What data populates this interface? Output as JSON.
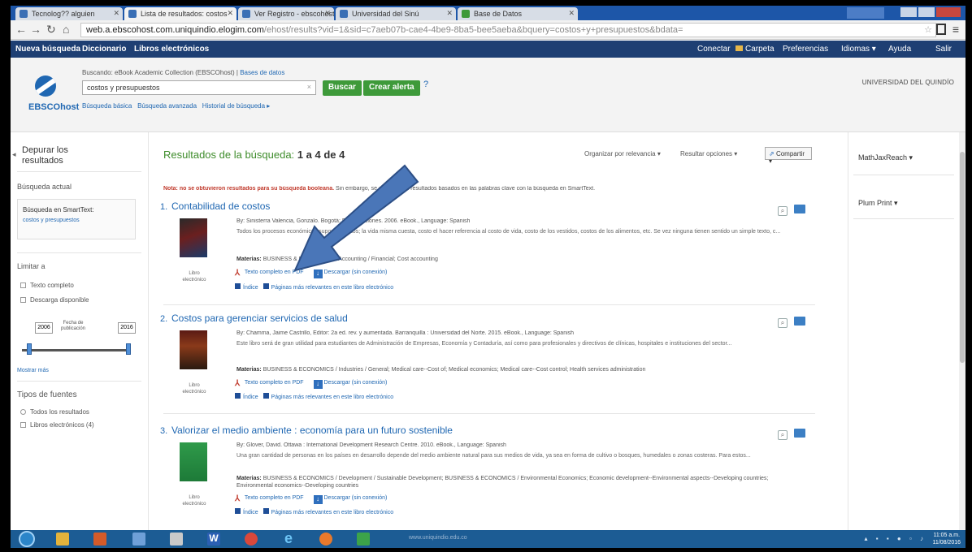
{
  "browser": {
    "tabs": [
      {
        "label": "Tecnolog?? alguien"
      },
      {
        "label": "Lista de resultados: costos"
      },
      {
        "label": "Ver Registro - ebscohost"
      },
      {
        "label": "Universidad del Sinú"
      },
      {
        "label": "Base de Datos"
      }
    ],
    "url_main": "web.a.ebscohost.com.uniquindio.elogim.com",
    "url_rest": "/ehost/results?vid=1&sid=c7aeb07b-cae4-4be9-8ba5-bee5aeba&bquery=costos+y+presupuestos&bdata="
  },
  "toolbar": {
    "left": [
      "Nueva búsqueda",
      "Diccionario",
      "Libros electrónicos"
    ],
    "right": [
      "Conectar",
      "Carpeta",
      "Preferencias",
      "Idiomas",
      "Ayuda",
      "Salir"
    ]
  },
  "header": {
    "searching_label": "Buscando: eBook Academic Collection (EBSCOhost)",
    "searching_link": "Bases de datos",
    "query": "costos y presupuestos",
    "search_button": "Buscar",
    "alert_button": "Crear alerta",
    "help": "?",
    "links": [
      "Búsqueda básica",
      "Búsqueda avanzada",
      "Historial de búsqueda"
    ],
    "institution": "UNIVERSIDAD DEL QUINDÍO",
    "logo": "EBSCOhost"
  },
  "left": {
    "refine_title": "Depurar los resultados",
    "current_search": "Búsqueda actual",
    "smarttext_title": "Búsqueda en SmartText:",
    "smarttext_link": "costos y presupuestos",
    "limit_to": "Limitar a",
    "opt_fulltext": "Texto completo",
    "opt_download": "Descarga disponible",
    "year_from": "2006",
    "year_to": "2016",
    "pubdate_label": "Fecha de publicación",
    "show_more": "Mostrar más",
    "source_types": "Tipos de fuentes",
    "opt_all": "Todos los resultados",
    "opt_ebooks": "Libros electrónicos (4)"
  },
  "main": {
    "results_label": "Resultados de la búsqueda:",
    "results_range": "1 a 4 de 4",
    "sort": "Organizar por relevancia",
    "page_options": "Resultar opciones",
    "share": "Compartir",
    "note_bold": "Nota: no se obtuvieron resultados para su búsqueda booleana.",
    "note_rest": " Sin embargo, se encontraron resultados basados en las palabras clave con la búsqueda en SmartText.",
    "results": [
      {
        "num": "1.",
        "title": "Contabilidad de costos",
        "byline": "By: Sinisterra Valencia, Gonzalo. Bogotá: Ecoe Ediciones. 2006. eBook., Language: Spanish",
        "abstract": "Todos los procesos económicos suponen costos; la vida misma cuesta, costo el hacer referencia al costo de vida, costo de los vestidos, costos de los alimentos, etc. Se vez ninguna tienen sentido un simple texto, c...",
        "subjects": "BUSINESS & ECONOMICS / Accounting / Financial; Cost accounting",
        "cover_label": "Libro electrónico",
        "pdf": "Texto completo en PDF",
        "download": "Descargar (sin conexión)",
        "index": "Índice",
        "pages": "Páginas más relevantes en este libro electrónico"
      },
      {
        "num": "2.",
        "title": "Costos para gerenciar servicios de salud",
        "byline": "By: Chamma, Jaime Castrillo, Editor: 2a ed. rev. y aumentada. Barranquilla : Universidad del Norte. 2015. eBook., Language: Spanish",
        "abstract": "Este libro será de gran utilidad para estudiantes de Administración de Empresas, Economía y Contaduría, así como para profesionales y directivos de clínicas, hospitales e instituciones del sector...",
        "subjects": "BUSINESS & ECONOMICS / Industries / General; Medical care--Cost of; Medical economics; Medical care--Cost control; Health services administration",
        "cover_label": "Libro electrónico",
        "pdf": "Texto completo en PDF",
        "download": "Descargar (sin conexión)",
        "index": "Índice",
        "pages": "Páginas más relevantes en este libro electrónico"
      },
      {
        "num": "3.",
        "title": "Valorizar el medio ambiente : economía para un futuro sostenible",
        "byline": "By: Glover, David. Ottawa : International Development Research Centre. 2010. eBook., Language: Spanish",
        "abstract": "Una gran cantidad de personas en los países en desarrollo depende del medio ambiente natural para sus medios de vida, ya sea en forma de cultivo o bosques, humedales o zonas costeras. Para estos...",
        "subjects": "BUSINESS & ECONOMICS / Development / Sustainable Development; BUSINESS & ECONOMICS / Environmental Economics; Economic development--Environmental aspects--Developing countries; Environmental economics--Developing countries",
        "cover_label": "Libro electrónico",
        "pdf": "Texto completo en PDF",
        "download": "Descargar (sin conexión)",
        "index": "Índice",
        "pages": "Páginas más relevantes en este libro electrónico"
      }
    ],
    "subjects_label": "Materias:"
  },
  "right": {
    "item1": "MathJaxReach",
    "item2": "Plum Print"
  },
  "taskbar": {
    "url_hint": "www.uniquindio.edu.co",
    "clock_time": "11:05 a.m.",
    "clock_date": "11/08/2016"
  },
  "colors": {
    "toolbar": "#1e3f73",
    "accent_green": "#3e9a3a",
    "link_blue": "#1f67b2",
    "arrow": "#4a76b8"
  }
}
